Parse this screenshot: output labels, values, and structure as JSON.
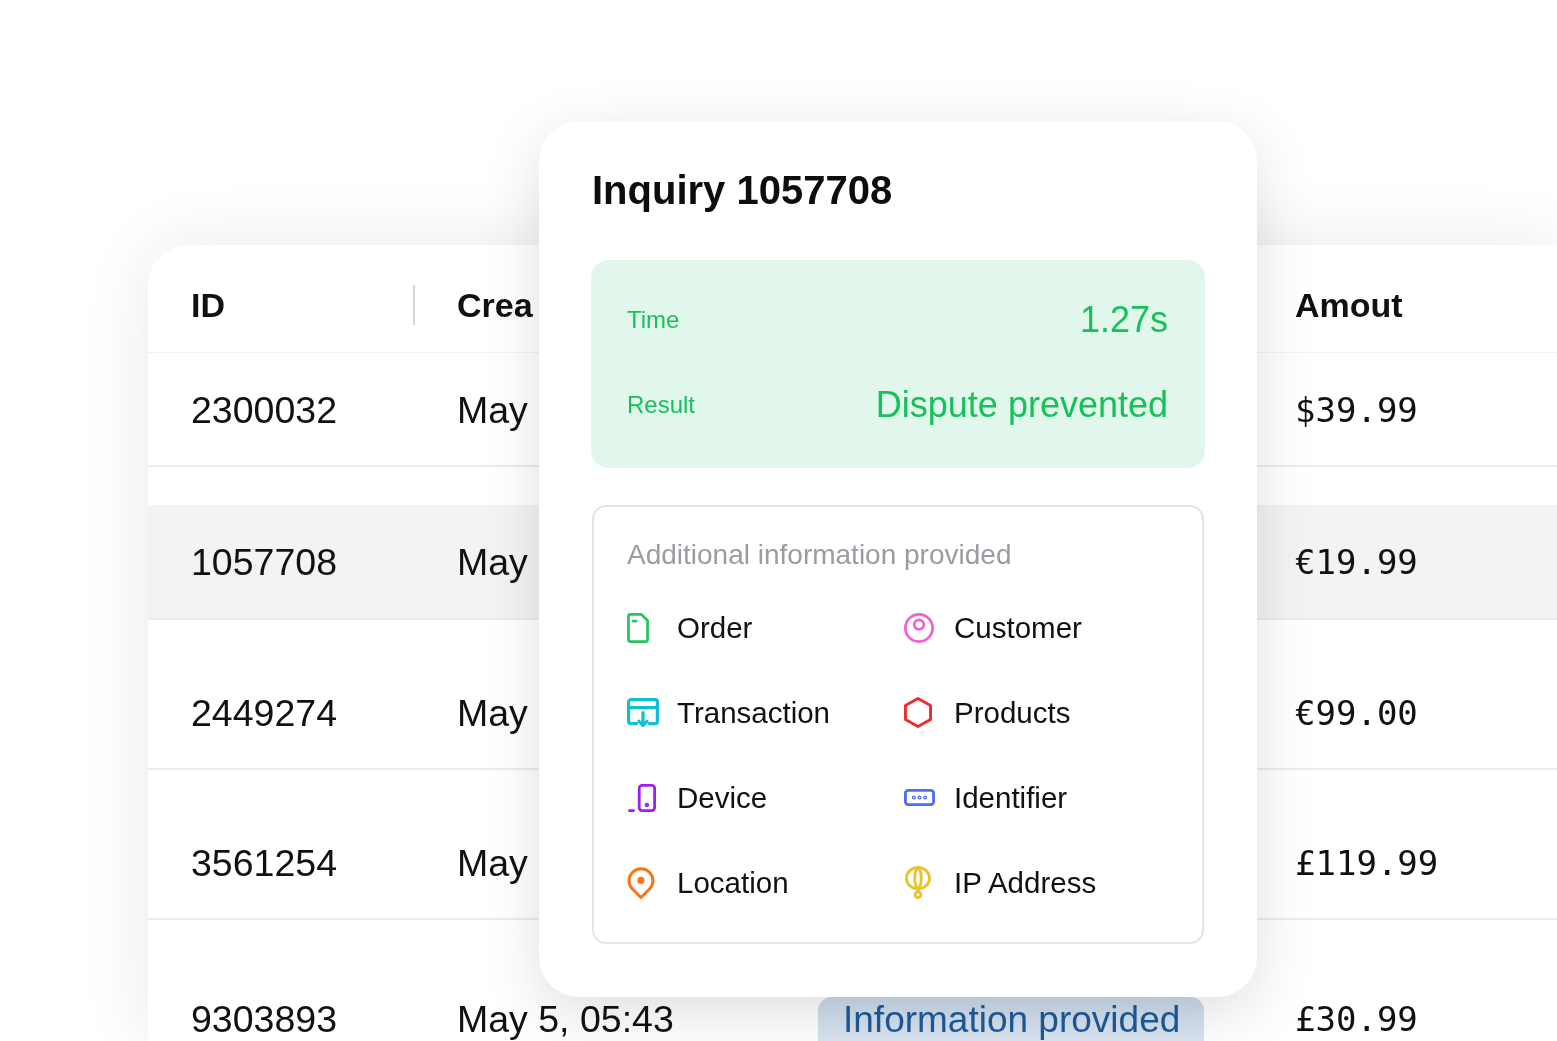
{
  "table": {
    "columns": [
      "ID",
      "Crea",
      "Amout"
    ],
    "rows": [
      {
        "id": "2300032",
        "created": "May",
        "amount": "$39.99",
        "selected": false
      },
      {
        "id": "1057708",
        "created": "May",
        "amount": "€19.99",
        "selected": true
      },
      {
        "id": "2449274",
        "created": "May",
        "amount": "€99.00",
        "selected": false
      },
      {
        "id": "3561254",
        "created": "May",
        "amount": "£119.99",
        "selected": false
      },
      {
        "id": "9303893",
        "created": "May 5, 05:43",
        "status": "Information provided",
        "amount": "£30.99",
        "selected": false
      }
    ]
  },
  "inquiry": {
    "title": "Inquiry 1057708",
    "summary": [
      {
        "label": "Time",
        "value": "1.27s"
      },
      {
        "label": "Result",
        "value": "Dispute prevented"
      }
    ],
    "info": {
      "heading": "Additional information provided",
      "items": [
        {
          "label": "Order",
          "color": "#22c55e"
        },
        {
          "label": "Customer",
          "color": "#f25fd2"
        },
        {
          "label": "Transaction",
          "color": "#13bdd6"
        },
        {
          "label": "Products",
          "color": "#ef2d2d"
        },
        {
          "label": "Device",
          "color": "#9d1ef2"
        },
        {
          "label": "Identifier",
          "color": "#4f6cf7"
        },
        {
          "label": "Location",
          "color": "#f97316"
        },
        {
          "label": "IP Address",
          "color": "#e9c32c"
        }
      ]
    }
  }
}
